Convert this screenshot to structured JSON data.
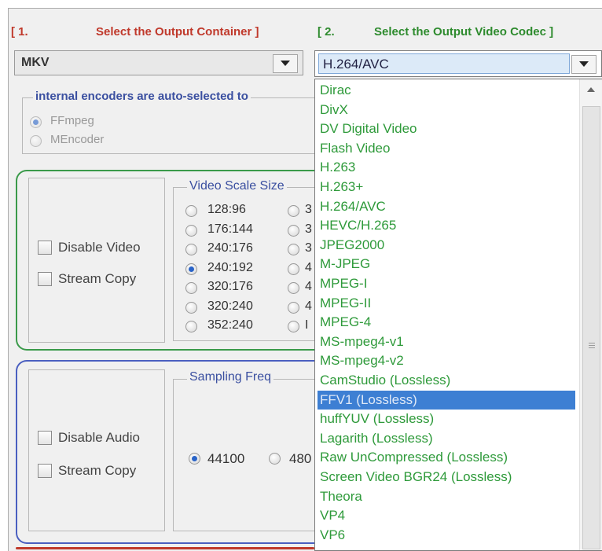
{
  "step1": {
    "label": "[ 1.",
    "title": "Select the Output Container ]",
    "value": "MKV"
  },
  "step2": {
    "label": "[ 2.",
    "title": "Select the Output Video Codec ]",
    "value": "H.264/AVC"
  },
  "encoders": {
    "text": "internal encoders are auto-selected to",
    "options": [
      "FFmpeg",
      "MEncoder"
    ],
    "selected": "FFmpeg"
  },
  "video": {
    "disable_label": "Disable Video",
    "stream_copy_label": "Stream Copy",
    "scale_title": "Video Scale Size",
    "sizes": [
      "128:96",
      "176:144",
      "240:176",
      "240:192",
      "320:176",
      "320:240",
      "352:240"
    ],
    "selected_size": "240:192",
    "second_column_hints": [
      "3",
      "3",
      "3",
      "4",
      "4",
      "4",
      "I"
    ]
  },
  "audio": {
    "disable_label": "Disable Audio",
    "stream_copy_label": "Stream Copy",
    "freq_title": "Sampling Freq",
    "freqs": [
      "44100",
      "480"
    ],
    "selected_freq": "44100"
  },
  "codec_list": {
    "items": [
      "Dirac",
      "DivX",
      "DV Digital Video",
      "Flash Video",
      "H.263",
      "H.263+",
      "H.264/AVC",
      "HEVC/H.265",
      "JPEG2000",
      "M-JPEG",
      "MPEG-I",
      "MPEG-II",
      "MPEG-4",
      "MS-mpeg4-v1",
      "MS-mpeg4-v2",
      "CamStudio (Lossless)",
      "FFV1 (Lossless)",
      "huffYUV (Lossless)",
      "Lagarith (Lossless)",
      "Raw UnCompressed (Lossless)",
      "Screen Video BGR24 (Lossless)",
      "Theora",
      "VP4",
      "VP6"
    ],
    "selected": "FFV1 (Lossless)"
  },
  "colors": {
    "green_group": "#3a9a4a",
    "blue_group": "#4a5fc0",
    "list_text": "#2e9a3a",
    "selection": "#3d7fd3"
  }
}
